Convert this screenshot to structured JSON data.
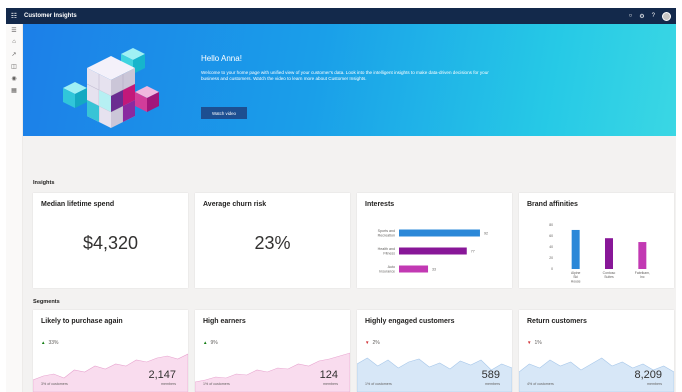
{
  "app": {
    "title": "Customer Insights"
  },
  "topbar_icons": [
    "bell-icon",
    "gear-icon",
    "help-icon",
    "avatar"
  ],
  "rail_icons": [
    "hamburger-icon",
    "home-icon",
    "share-icon",
    "people-icon",
    "tag-icon",
    "document-icon"
  ],
  "hero": {
    "greeting": "Hello Anna!",
    "message": "Welcome to your home page with unified view of your customer's data. Look into the intelligent insights to make data-driven decisions for your business and customers.  Watch the video to learn more about Customer Insights.",
    "button_label": "Watch video"
  },
  "insights": {
    "section_label": "Insights",
    "cards": [
      {
        "title": "Median lifetime spend",
        "value": "$4,320"
      },
      {
        "title": "Average churn risk",
        "value": "23%"
      },
      {
        "title": "Interests"
      },
      {
        "title": "Brand affinities"
      }
    ]
  },
  "chart_data": [
    {
      "type": "bar",
      "orientation": "horizontal",
      "categories": [
        "Sports and Recreation",
        "Health and Fitness",
        "Auto Insurance"
      ],
      "values": [
        92,
        77,
        33
      ],
      "colors": [
        "#2b88d8",
        "#881798",
        "#c239b3"
      ]
    },
    {
      "type": "bar",
      "categories": [
        "Alpine Ski House",
        "Contoso Suites",
        "Fabrikam, Inc"
      ],
      "values": [
        71,
        56,
        49
      ],
      "yticks": [
        0,
        20,
        40,
        60,
        80
      ],
      "ylim": [
        0,
        80
      ],
      "colors": [
        "#2b88d8",
        "#881798",
        "#c239b3"
      ]
    }
  ],
  "segments": {
    "section_label": "Segments",
    "cards": [
      {
        "title": "Likely to purchase again",
        "trend": "up",
        "change": "33%",
        "sub": "3% of customers",
        "count": "2,147",
        "members_label": "members",
        "fill": "#f9dcee",
        "stroke": "#e8a5d0"
      },
      {
        "title": "High earners",
        "trend": "up",
        "change": "9%",
        "sub": "1% of customers",
        "count": "124",
        "members_label": "members",
        "fill": "#f9dcee",
        "stroke": "#e8a5d0"
      },
      {
        "title": "Highly engaged customers",
        "trend": "down",
        "change": "2%",
        "sub": "1% of customers",
        "count": "589",
        "members_label": "members",
        "fill": "#d7e7f7",
        "stroke": "#a8c8ea"
      },
      {
        "title": "Return customers",
        "trend": "down",
        "change": "1%",
        "sub": "4% of customers",
        "count": "8,209",
        "members_label": "members",
        "fill": "#d7e7f7",
        "stroke": "#a8c8ea"
      }
    ]
  }
}
